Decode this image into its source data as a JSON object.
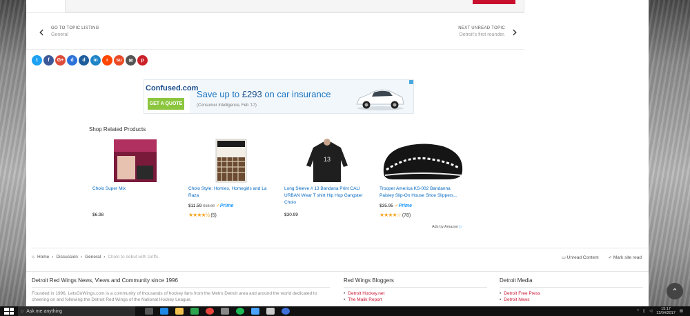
{
  "nav": {
    "prev_label": "GO TO TOPIC LISTING",
    "prev_sub": "General",
    "next_label": "NEXT UNREAD TOPIC",
    "next_sub": "Detroit's first rounder."
  },
  "share_icons": [
    {
      "name": "twitter-icon",
      "glyph": "t",
      "color": "#1da1f2"
    },
    {
      "name": "facebook-icon",
      "glyph": "f",
      "color": "#3b5998"
    },
    {
      "name": "google-plus-icon",
      "glyph": "G+",
      "color": "#dd4b39"
    },
    {
      "name": "delicious-icon",
      "glyph": "d",
      "color": "#2d72d9"
    },
    {
      "name": "digg-icon",
      "glyph": "d",
      "color": "#1d5d9b"
    },
    {
      "name": "linkedin-icon",
      "glyph": "in",
      "color": "#1d84c6"
    },
    {
      "name": "reddit-icon",
      "glyph": "r",
      "color": "#ff4500"
    },
    {
      "name": "stumbleupon-icon",
      "glyph": "su",
      "color": "#eb4924"
    },
    {
      "name": "email-icon",
      "glyph": "✉",
      "color": "#555555"
    },
    {
      "name": "pinterest-icon",
      "glyph": "p",
      "color": "#cb2027"
    }
  ],
  "ad": {
    "logo": "Confused.com",
    "cta": "GET A QUOTE",
    "headline_pre": "Save up to ",
    "headline_amount": "£293",
    "headline_post": " on car insurance",
    "subtext": "(Consumer Intelligence, Feb '17)"
  },
  "shop": {
    "title": "Shop Related Products",
    "products": [
      {
        "title": "Cholo Super Mix",
        "price": "$6.98",
        "old_price": "",
        "prime": false,
        "stars": "",
        "reviews": ""
      },
      {
        "title": "Cholo Style: Homies, Homegirls and La Raza",
        "price": "$11.59",
        "old_price": "$18.00",
        "prime": true,
        "stars": "★★★★½",
        "reviews": "(5)"
      },
      {
        "title": "Long Sleeve # 13 Bandana Print CALI URBAN Wear T shirt Hip Hop Gangster Cholo",
        "price": "$30.99",
        "old_price": "",
        "prime": false,
        "stars": "",
        "reviews": ""
      },
      {
        "title": "Trooper America KS-002 Bandanna Paisley Slip-On House Shoe Slippers...",
        "price": "$35.95",
        "old_price": "",
        "prime": true,
        "stars": "★★★★☆",
        "reviews": "(78)"
      }
    ],
    "ads_by": "Ads by Amazon",
    "prime_label": "Prime"
  },
  "breadcrumb": {
    "items": [
      "Home",
      "Discussion",
      "General"
    ],
    "current": "Cholo to debut with Griffs.",
    "unread": "Unread Content",
    "mark_read": "Mark site read"
  },
  "footer": {
    "about_title": "Detroit Red Wings News, Views and Community since 1996",
    "about_text": "Founded in 1996, LetsGoWings.com is a community of thousands of hockey fans from the Metro Detroit area and around the world dedicated to cheering on and following the Detroit Red Wings of the National Hockey League.",
    "bloggers_title": "Red Wings Bloggers",
    "bloggers": [
      "Detroit Hockey.net",
      "The Malik Report"
    ],
    "media_title": "Detroit Media",
    "media": [
      "Detroit Free Press",
      "Detroit News"
    ]
  },
  "taskbar": {
    "search_placeholder": "Ask me anything",
    "time": "15:17",
    "date": "12/04/2017"
  }
}
